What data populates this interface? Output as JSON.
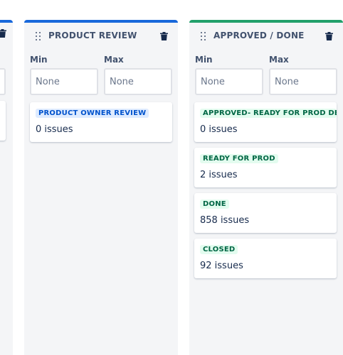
{
  "colors": {
    "blue_topbar": "#1868db",
    "green_topbar": "#22a06b",
    "column_bg": "#f4f5f7",
    "lozenge_blue_bg": "#deebff",
    "lozenge_blue_text": "#0052cc",
    "lozenge_green_bg": "#e3fcef",
    "lozenge_green_text": "#006644"
  },
  "columns": [
    {
      "title": "PRODUCT REVIEW",
      "min_label": "Min",
      "max_label": "Max",
      "min_placeholder": "None",
      "max_placeholder": "None",
      "statuses": [
        {
          "name": "PRODUCT OWNER REVIEW",
          "count": "0 issues"
        }
      ]
    },
    {
      "title": "APPROVED / DONE",
      "min_label": "Min",
      "max_label": "Max",
      "min_placeholder": "None",
      "max_placeholder": "None",
      "statuses": [
        {
          "name": "APPROVED- READY FOR PROD DE",
          "count": "0 issues"
        },
        {
          "name": "READY FOR PROD",
          "count": "2 issues"
        },
        {
          "name": "DONE",
          "count": "858 issues"
        },
        {
          "name": "CLOSED",
          "count": "92 issues"
        }
      ]
    }
  ]
}
